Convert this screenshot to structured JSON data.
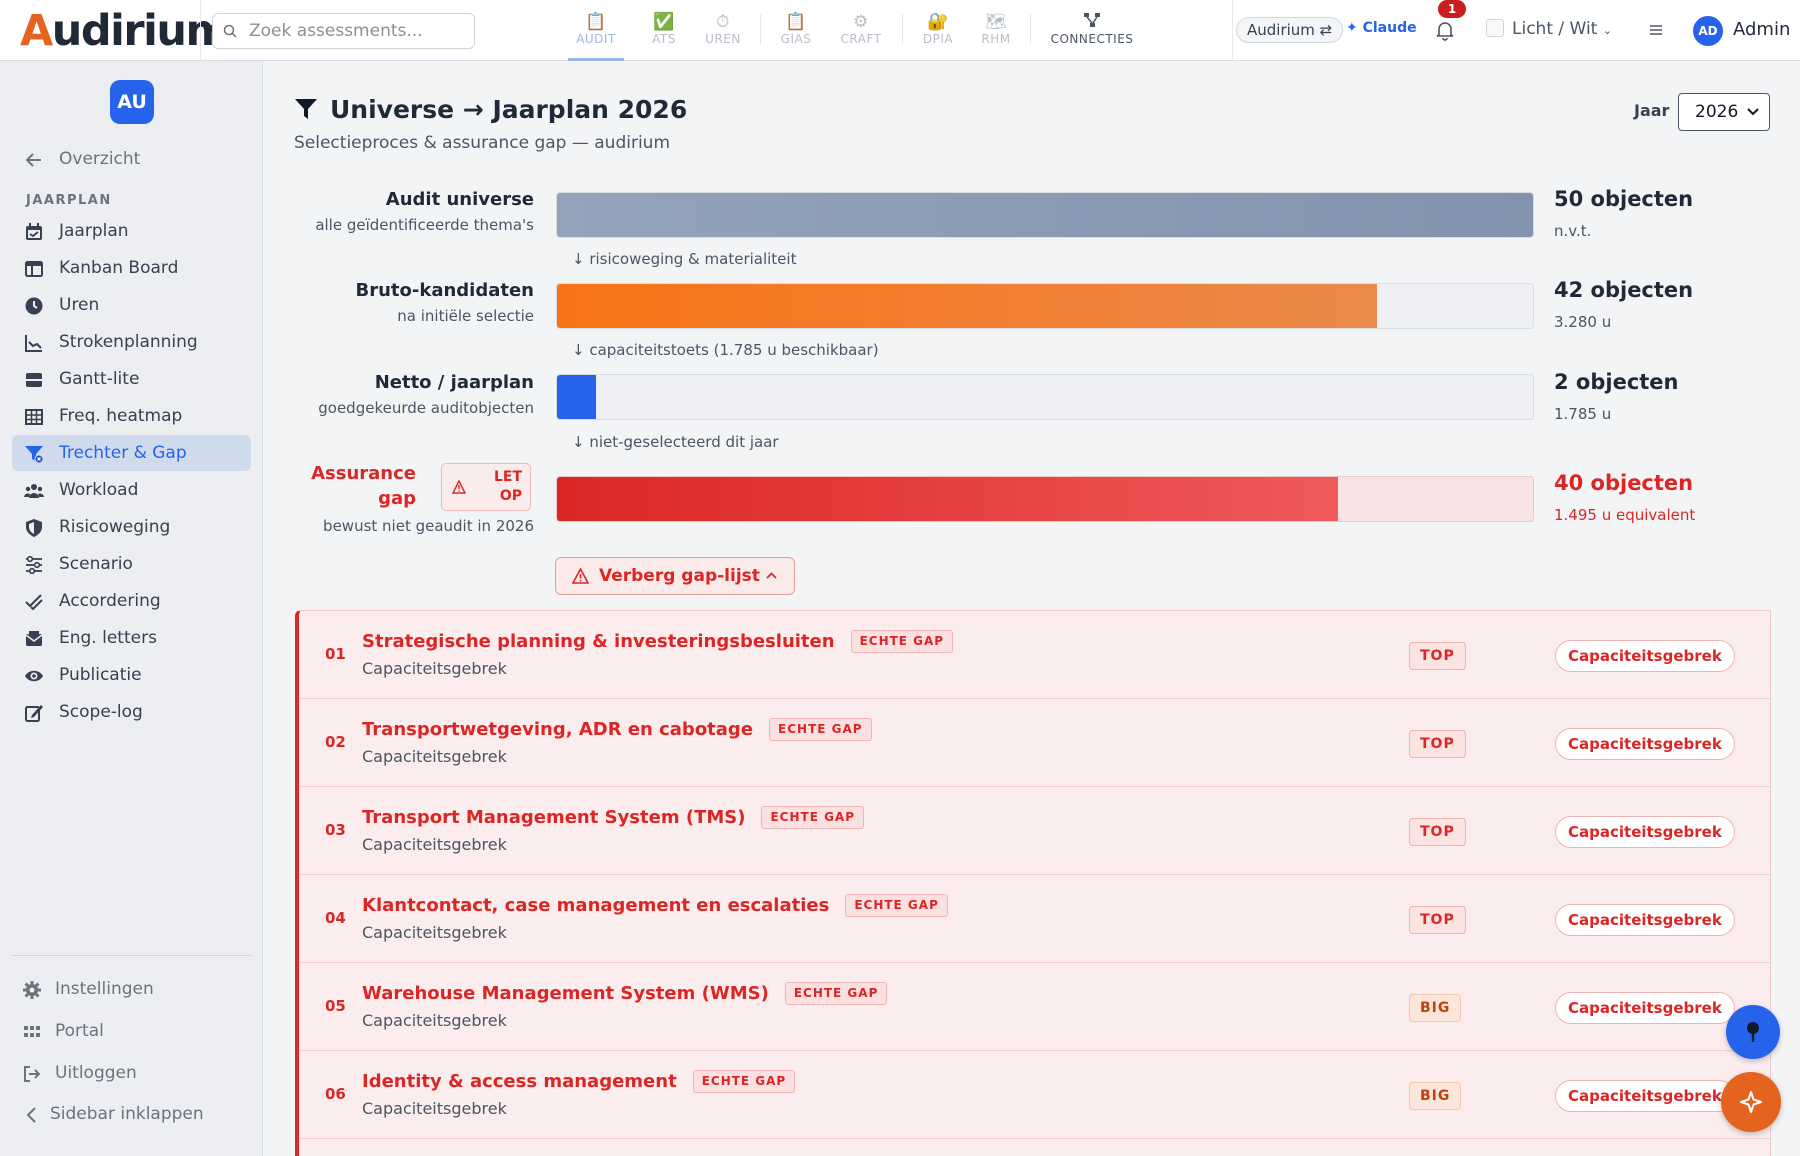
{
  "app": {
    "logo_first": "A",
    "logo_rest": "udirium"
  },
  "search": {
    "placeholder": "Zoek assessments..."
  },
  "modules": [
    {
      "label": "AUDIT",
      "icon": "clipboard-icon"
    },
    {
      "label": "ATS",
      "icon": "checkbox-icon"
    },
    {
      "label": "UREN",
      "icon": "stopwatch-icon"
    },
    {
      "label": "GIAS",
      "icon": "clipboard-icon"
    },
    {
      "label": "CRAFT",
      "icon": "gear-icon"
    },
    {
      "label": "DPIA",
      "icon": "lock-icon"
    },
    {
      "label": "RHM",
      "icon": "map-icon"
    },
    {
      "label": "CONNECTIES",
      "icon": "network-icon"
    }
  ],
  "topbar": {
    "tenant": "Audirium ⇄",
    "claude": "✦ Claude",
    "notif_count": "1",
    "theme": "Licht / Wit",
    "avatar": "AD",
    "user": "Admin"
  },
  "sidebar": {
    "avatar": "AU",
    "back": "Overzicht",
    "section": "JAARPLAN",
    "items": [
      {
        "label": "Jaarplan",
        "icon": "calendar-icon"
      },
      {
        "label": "Kanban Board",
        "icon": "kanban-icon"
      },
      {
        "label": "Uren",
        "icon": "clock-icon"
      },
      {
        "label": "Strokenplanning",
        "icon": "line-chart-icon"
      },
      {
        "label": "Gantt-lite",
        "icon": "gantt-icon"
      },
      {
        "label": "Freq. heatmap",
        "icon": "grid-icon"
      },
      {
        "label": "Trechter & Gap",
        "icon": "funnel-icon"
      },
      {
        "label": "Workload",
        "icon": "users-icon"
      },
      {
        "label": "Risicoweging",
        "icon": "shield-icon"
      },
      {
        "label": "Scenario",
        "icon": "sliders-icon"
      },
      {
        "label": "Accordering",
        "icon": "double-check-icon"
      },
      {
        "label": "Eng. letters",
        "icon": "envelope-icon"
      },
      {
        "label": "Publicatie",
        "icon": "eye-icon"
      },
      {
        "label": "Scope-log",
        "icon": "edit-icon"
      }
    ],
    "footer": [
      {
        "label": "Instellingen",
        "icon": "gear-icon"
      },
      {
        "label": "Portal",
        "icon": "grid-dots-icon"
      },
      {
        "label": "Uitloggen",
        "icon": "logout-icon"
      },
      {
        "label": "Sidebar inklappen",
        "icon": "chevron-left-icon"
      }
    ]
  },
  "page": {
    "title": "Universe → Jaarplan 2026",
    "subtitle": "Selectieproces & assurance gap — audirium",
    "year_label": "Jaar",
    "year_value": "2026",
    "year_options": [
      "2026"
    ]
  },
  "funnel": [
    {
      "name": "Audit universe",
      "sub": "alle geïdentificeerde thema's",
      "value": "50 objecten",
      "value_sub": "n.v.t.",
      "fill_fraction": 1.0,
      "color": "#8393ad"
    },
    {
      "name": "Bruto-kandidaten",
      "sub": "na initiële selectie",
      "value": "42 objecten",
      "value_sub": "3.280 u",
      "fill_fraction": 0.84,
      "color": "#f07a22"
    },
    {
      "name": "Netto / jaarplan",
      "sub": "goedgekeurde auditobjecten",
      "value": "2 objecten",
      "value_sub": "1.785 u",
      "fill_fraction": 0.04,
      "color": "#2563eb"
    },
    {
      "name_line1": "Assurance",
      "name_line2": "gap",
      "sub": "bewust niet geaudit in 2026",
      "value": "40 objecten",
      "value_sub": "1.495 u equivalent",
      "fill_fraction": 0.8,
      "color": "#dc2626",
      "warning_line1": "LET",
      "warning_line2": "OP"
    }
  ],
  "steps": [
    "↓  risicoweging & materialiteit",
    "↓  capaciteitstoets (1.785 u beschikbaar)",
    "↓  niet-geselecteerd dit jaar"
  ],
  "gap_toggle": "Verberg gap-lijst",
  "gap_list": [
    {
      "num": "01",
      "title": "Strategische planning & investeringsbesluiten",
      "badge": "ECHTE GAP",
      "sub": "Capaciteitsgebrek",
      "prio": "TOP",
      "reason": "Capaciteitsgebrek"
    },
    {
      "num": "02",
      "title": "Transportwetgeving, ADR en cabotage",
      "badge": "ECHTE GAP",
      "sub": "Capaciteitsgebrek",
      "prio": "TOP",
      "reason": "Capaciteitsgebrek"
    },
    {
      "num": "03",
      "title": "Transport Management System (TMS)",
      "badge": "ECHTE GAP",
      "sub": "Capaciteitsgebrek",
      "prio": "TOP",
      "reason": "Capaciteitsgebrek"
    },
    {
      "num": "04",
      "title": "Klantcontact, case management en escalaties",
      "badge": "ECHTE GAP",
      "sub": "Capaciteitsgebrek",
      "prio": "TOP",
      "reason": "Capaciteitsgebrek"
    },
    {
      "num": "05",
      "title": "Warehouse Management System (WMS)",
      "badge": "ECHTE GAP",
      "sub": "Capaciteitsgebrek",
      "prio": "BIG",
      "reason": "Capaciteitsgebrek"
    },
    {
      "num": "06",
      "title": "Identity & access management",
      "badge": "ECHTE GAP",
      "sub": "Capaciteitsgebrek",
      "prio": "BIG",
      "reason": "Capaciteitsgebrek"
    }
  ]
}
